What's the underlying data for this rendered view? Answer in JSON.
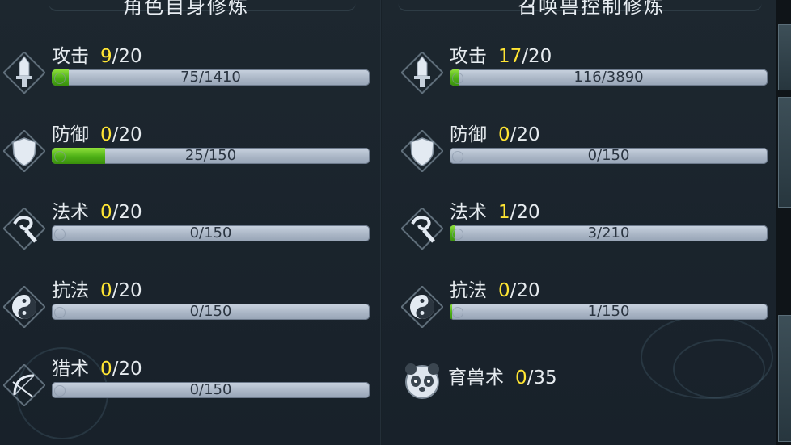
{
  "left_panel": {
    "title": "角色自身修炼",
    "rows": [
      {
        "name": "攻击",
        "cur": "9",
        "max": "/20",
        "bar_text": "75/1410",
        "progress": 0.053,
        "icon": "sword-icon"
      },
      {
        "name": "防御",
        "cur": "0",
        "max": "/20",
        "bar_text": "25/150",
        "progress": 0.167,
        "icon": "shield-icon"
      },
      {
        "name": "法术",
        "cur": "0",
        "max": "/20",
        "bar_text": "0/150",
        "progress": 0,
        "icon": "magic-staff-icon"
      },
      {
        "name": "抗法",
        "cur": "0",
        "max": "/20",
        "bar_text": "0/150",
        "progress": 0,
        "icon": "yin-yang-icon"
      },
      {
        "name": "猎术",
        "cur": "0",
        "max": "/20",
        "bar_text": "0/150",
        "progress": 0,
        "icon": "bow-icon"
      }
    ]
  },
  "right_panel": {
    "title": "召唤兽控制修炼",
    "rows": [
      {
        "name": "攻击",
        "cur": "17",
        "max": "/20",
        "bar_text": "116/3890",
        "progress": 0.03,
        "icon": "sword-icon"
      },
      {
        "name": "防御",
        "cur": "0",
        "max": "/20",
        "bar_text": "0/150",
        "progress": 0,
        "icon": "shield-icon"
      },
      {
        "name": "法术",
        "cur": "1",
        "max": "/20",
        "bar_text": "3/210",
        "progress": 0.014,
        "icon": "magic-staff-icon"
      },
      {
        "name": "抗法",
        "cur": "0",
        "max": "/20",
        "bar_text": "1/150",
        "progress": 0.007,
        "icon": "yin-yang-icon"
      }
    ],
    "beast_skill": {
      "name": "育兽术",
      "cur": "0",
      "max": "/35",
      "icon": "panda-icon"
    }
  },
  "colors": {
    "accent_yellow": "#ffe533",
    "bar_fill": "#4db016",
    "bar_bg": "#b3bfcf"
  }
}
